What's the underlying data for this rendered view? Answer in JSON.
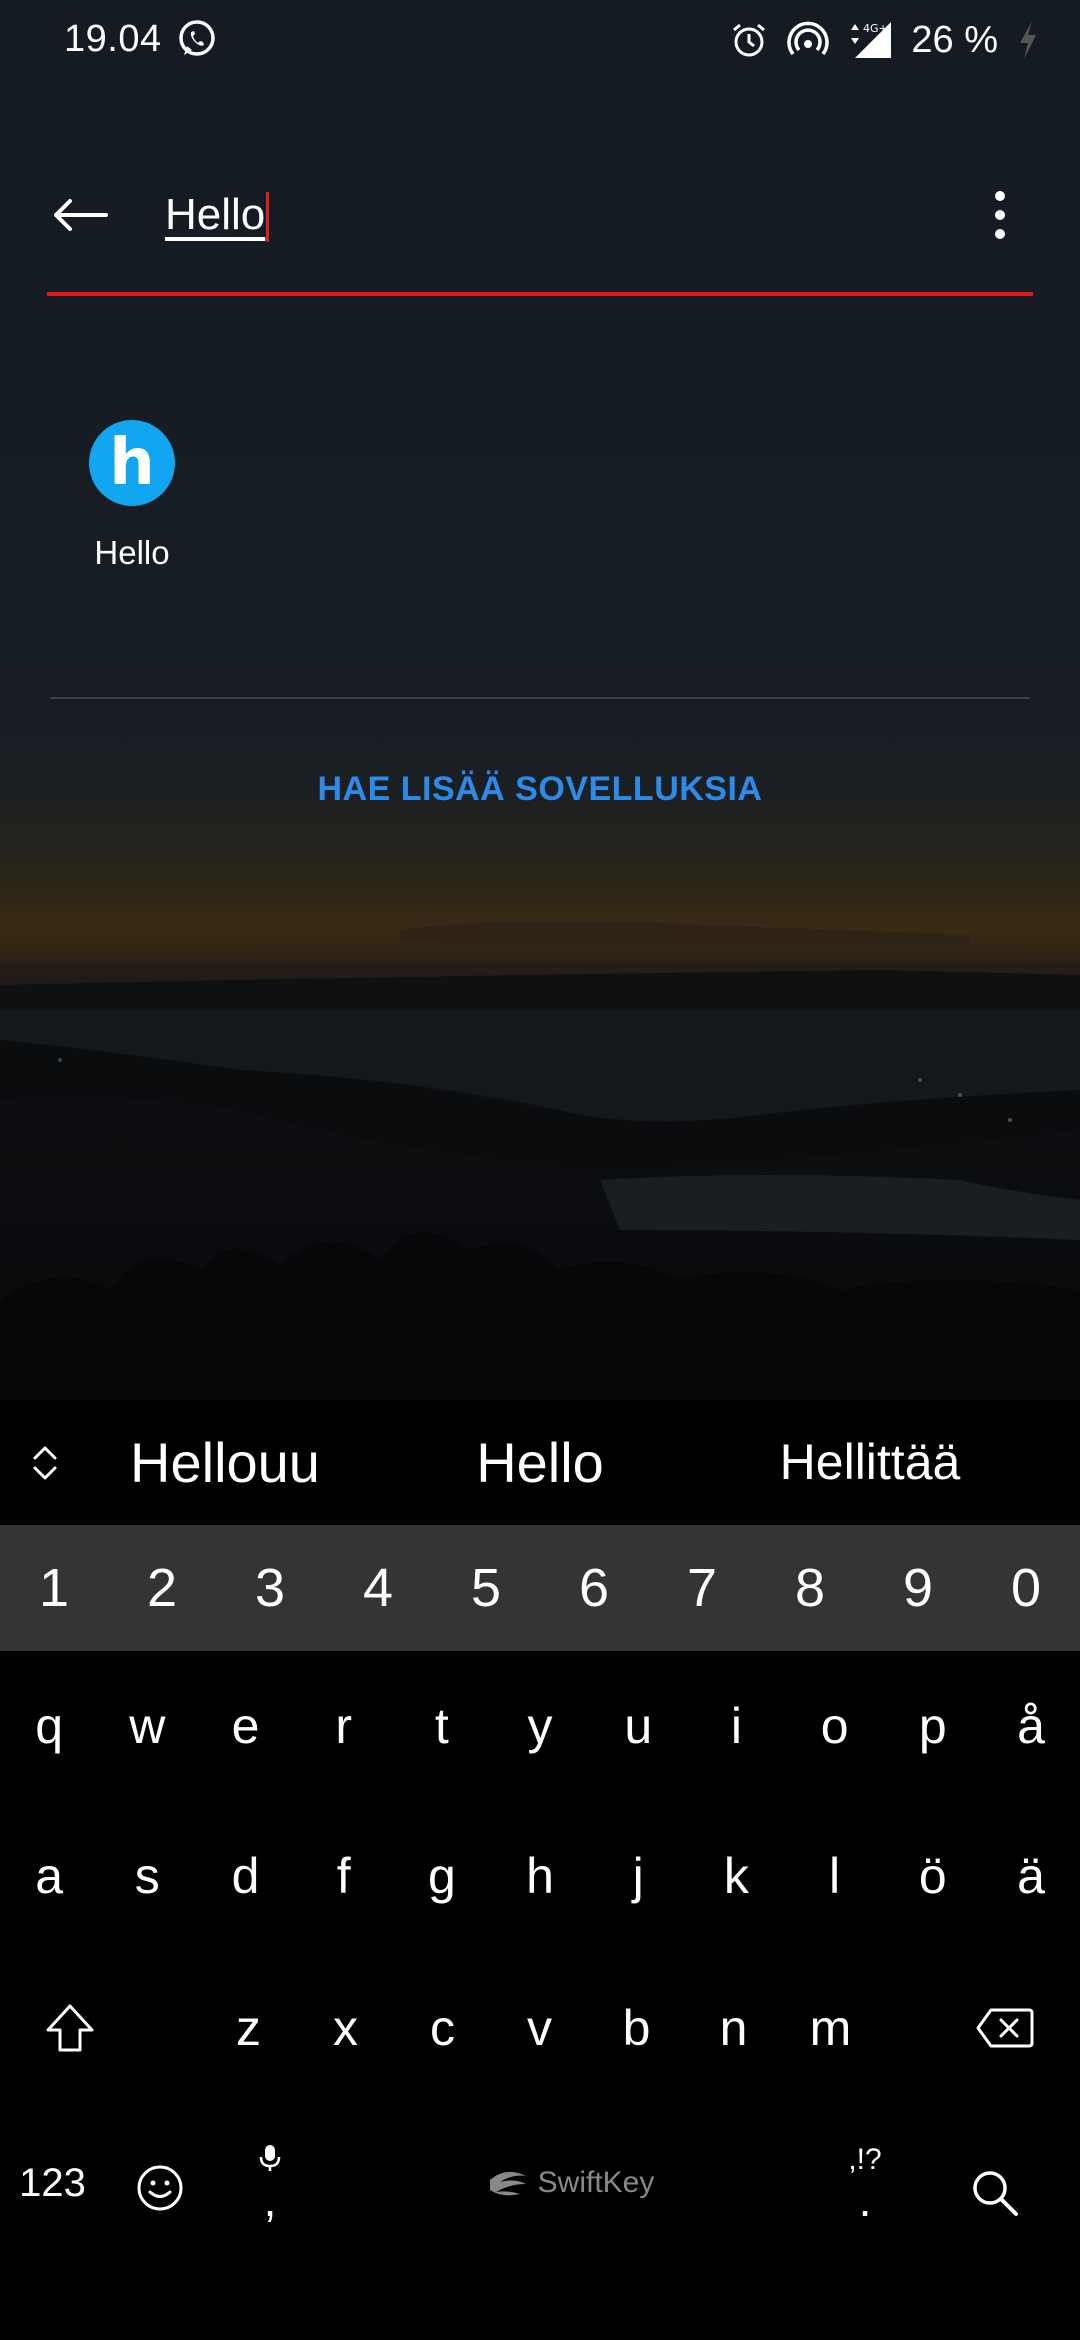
{
  "status_bar": {
    "time": "19.04",
    "battery_percent": "26 %",
    "network": "4G+",
    "icons": [
      "whatsapp-icon",
      "alarm-icon",
      "hotspot-icon",
      "signal-icon",
      "charging-icon"
    ]
  },
  "search": {
    "query": "Hello",
    "accent_color": "#e0181d"
  },
  "results": {
    "apps": [
      {
        "letter": "h",
        "label": "Hello",
        "icon_color": "#13a6f0"
      }
    ],
    "more_apps_link": "HAE LISÄÄ SOVELLUKSIA",
    "link_color": "#2d8ae8"
  },
  "keyboard": {
    "suggestions": [
      "Hellouu",
      "Hello",
      "Hellittää"
    ],
    "number_row": [
      "1",
      "2",
      "3",
      "4",
      "5",
      "6",
      "7",
      "8",
      "9",
      "0"
    ],
    "row1": [
      "q",
      "w",
      "e",
      "r",
      "t",
      "y",
      "u",
      "i",
      "o",
      "p",
      "å"
    ],
    "row2": [
      "a",
      "s",
      "d",
      "f",
      "g",
      "h",
      "j",
      "k",
      "l",
      "ö",
      "ä"
    ],
    "row3": [
      "z",
      "x",
      "c",
      "v",
      "b",
      "n",
      "m"
    ],
    "mode_key": "123",
    "comma": ",",
    "punctuation_alt": ",!?",
    "period": ".",
    "space_brand": "SwiftKey"
  }
}
